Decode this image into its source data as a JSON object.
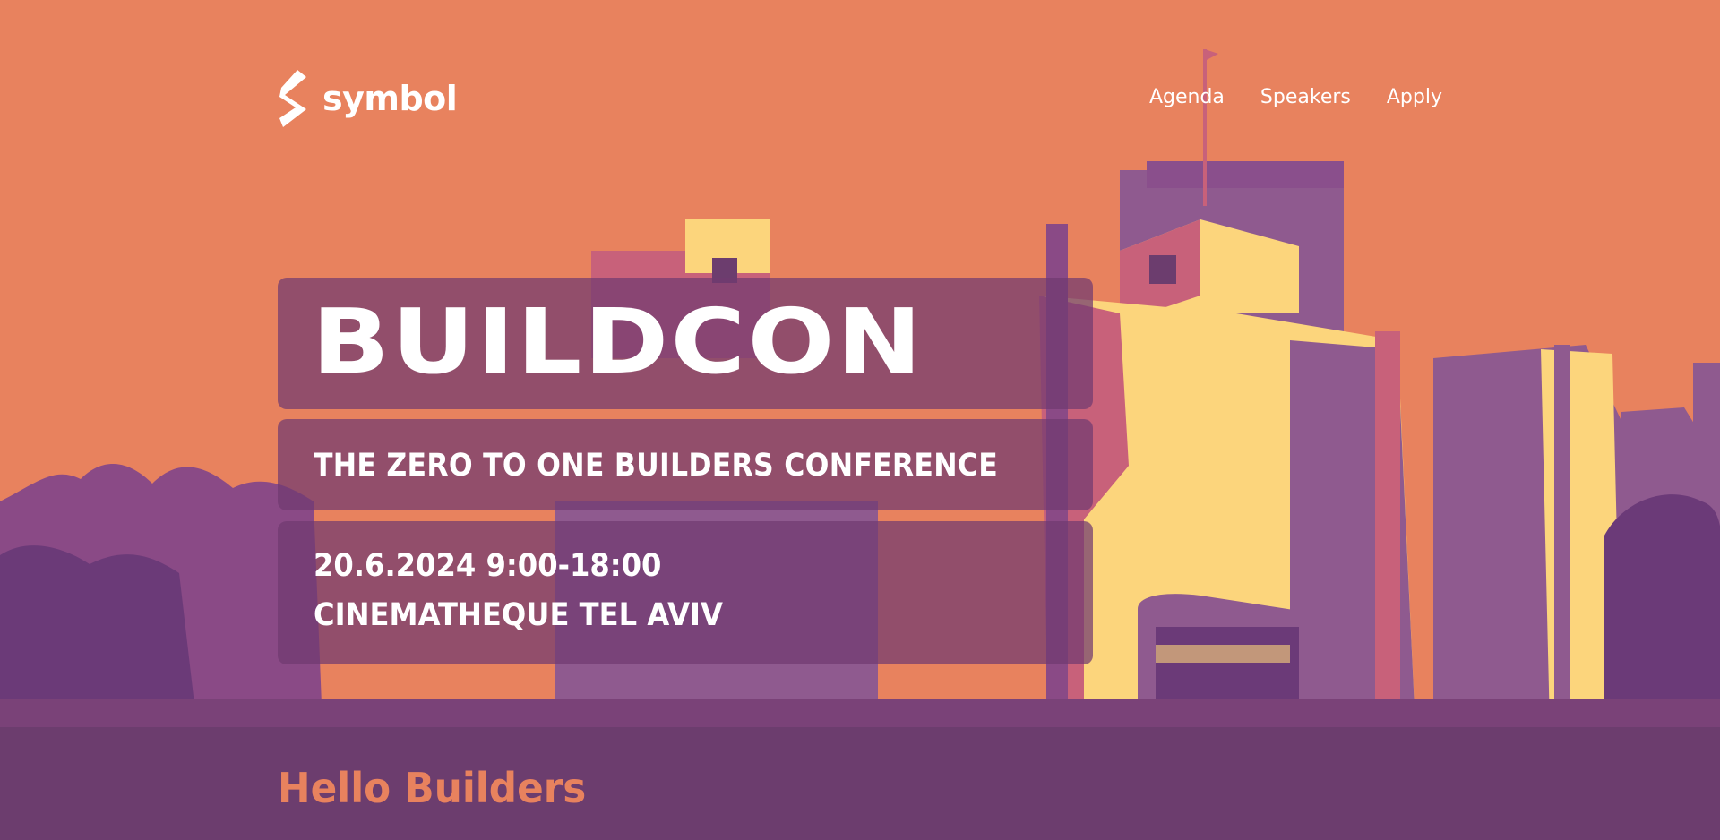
{
  "brand": {
    "name": "symbol",
    "logo_icon": "symbol-s-icon"
  },
  "nav": {
    "items": [
      "Agenda",
      "Speakers",
      "Apply"
    ]
  },
  "hero": {
    "title": "BUILDCON",
    "tagline": "THE ZERO TO ONE BUILDERS CONFERENCE",
    "date": "20.6.2024 9:00-18:00",
    "venue": "CINEMATHEQUE TEL AVIV",
    "image": "stylized-building-illustration"
  },
  "section": {
    "heading": "Hello Builders"
  },
  "colors": {
    "orange": "#e8825e",
    "purple": "#6c3d6e",
    "mauve": "#8f5a8f",
    "pink": "#c8617a",
    "yellow": "#fcd57c",
    "white": "#ffffff"
  }
}
